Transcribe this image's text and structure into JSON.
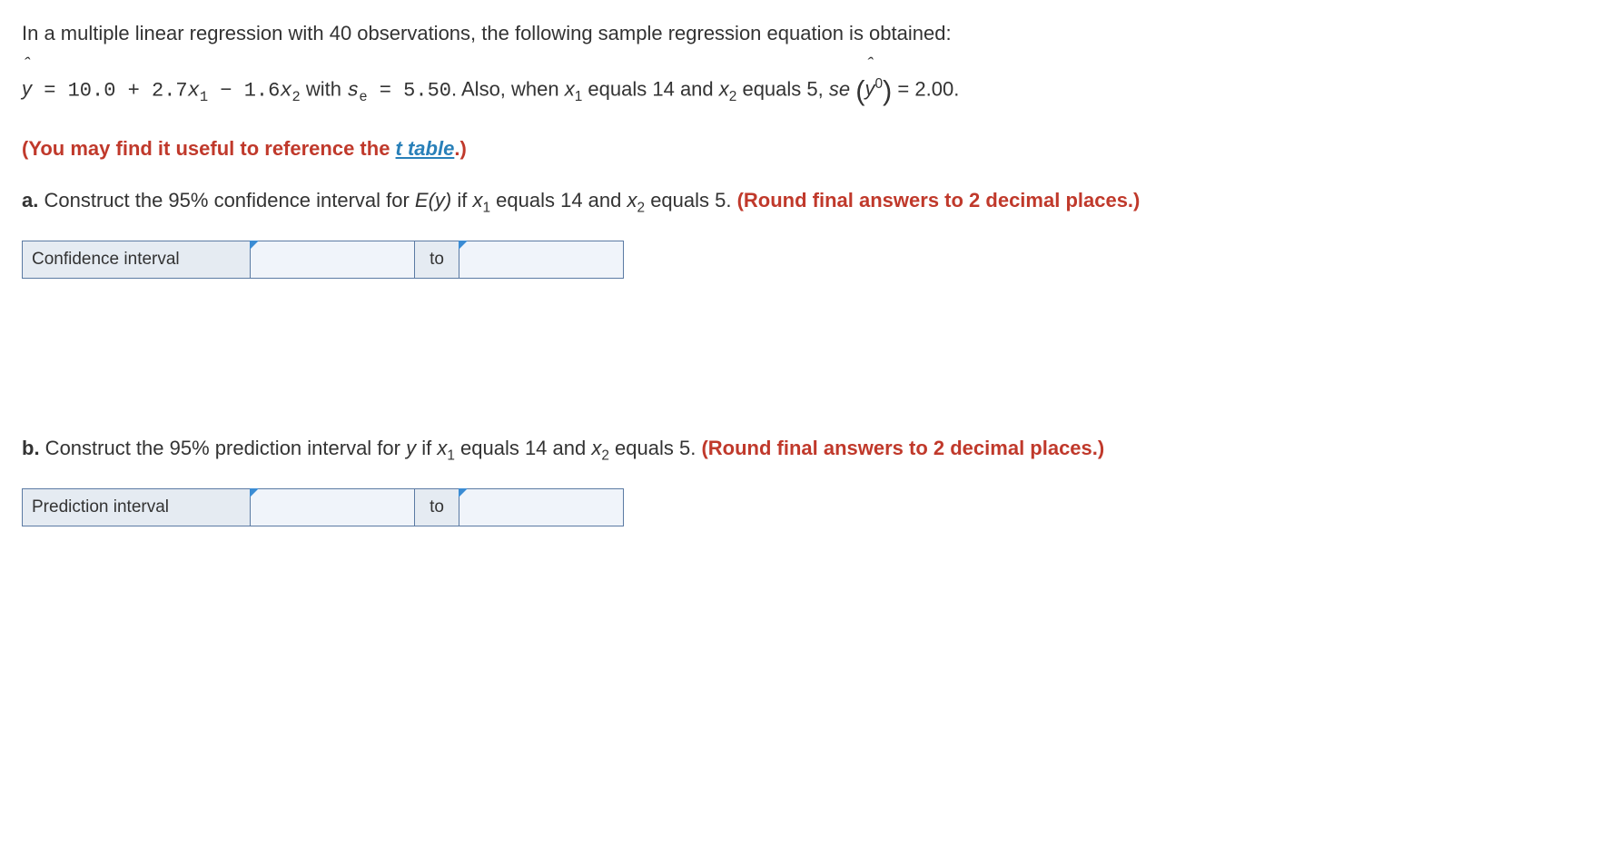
{
  "intro": "In a multiple linear regression with 40 observations, the following sample regression equation is obtained:",
  "equation": {
    "yhat": "y",
    "eq_part1": " = 10.0 + 2.7",
    "x1": "x",
    "x1_sub": "1",
    "minus": " − 1.6",
    "x2": "x",
    "x2_sub": "2",
    "with_text": " with ",
    "se_var": "s",
    "se_sub": "e",
    "se_val": " = 5.50",
    "also_text": ". Also, when ",
    "x1_again": "x",
    "x1_again_sub": "1",
    "eq14": " equals 14 and ",
    "x2_again": "x",
    "x2_again_sub": "2",
    "eq5": " equals 5, ",
    "se_word": "se ",
    "yhat0": "y",
    "yhat0_sup": "0",
    "eq200": " = 2.00."
  },
  "reference_pre": "(You may find it useful to reference the ",
  "reference_link": "t table",
  "reference_post": ".)",
  "part_a": {
    "label": "a.",
    "text_pre": " Construct the 95% confidence interval for ",
    "ey": "E(y)",
    "mid": " if ",
    "x1": "x",
    "x1_sub": "1",
    "eq14": " equals 14 and ",
    "x2": "x",
    "x2_sub": "2",
    "eq5": " equals 5. ",
    "round": "(Round final answers to 2 decimal places.)"
  },
  "part_b": {
    "label": "b.",
    "text_pre": " Construct the 95% prediction interval for ",
    "y": "y",
    "mid": " if ",
    "x1": "x",
    "x1_sub": "1",
    "eq14": " equals 14 and ",
    "x2": "x",
    "x2_sub": "2",
    "eq5": " equals 5. ",
    "round": "(Round final answers to 2 decimal places.)"
  },
  "table_a": {
    "label": "Confidence interval",
    "to": "to"
  },
  "table_b": {
    "label": "Prediction interval",
    "to": "to"
  }
}
